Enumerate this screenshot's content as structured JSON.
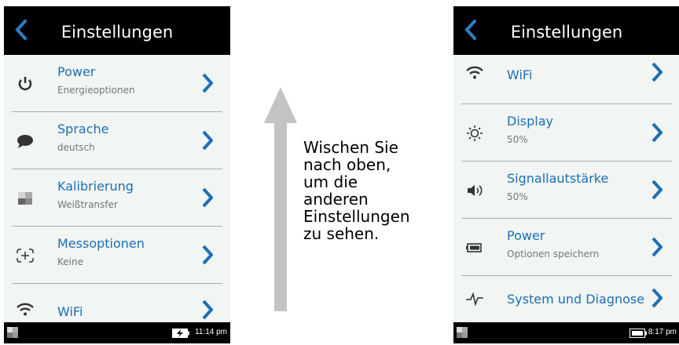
{
  "left_screen": {
    "title": "Einstellungen",
    "items": [
      {
        "label": "Power",
        "subtitle": "Energieoptionen"
      },
      {
        "label": "Sprache",
        "subtitle": "deutsch"
      },
      {
        "label": "Kalibrierung",
        "subtitle": "Weißtransfer"
      },
      {
        "label": "Messoptionen",
        "subtitle": "Keine"
      },
      {
        "label": "WiFi",
        "subtitle": ""
      }
    ],
    "time": "11:14 pm"
  },
  "instruction": "Wischen Sie\nnach oben,\num die\nanderen\nEinstellungen\nzu sehen.",
  "right_screen": {
    "title": "Einstellungen",
    "items": [
      {
        "label": "WiFi",
        "subtitle": ""
      },
      {
        "label": "Display",
        "subtitle": "50%"
      },
      {
        "label": "Signallautstärke",
        "subtitle": "50%"
      },
      {
        "label": "Power",
        "subtitle": "Optionen speichern"
      },
      {
        "label": "System und Diagnose",
        "subtitle": ""
      }
    ],
    "time": "8:17 pm"
  },
  "colors": {
    "accent": "#1c6fb5",
    "header": "#000000",
    "panel": "#f1f5f3",
    "arrow": "#c4c4c4"
  },
  "icons": [
    "back-chevron-icon",
    "power-icon",
    "speech-bubble-icon",
    "calibration-swatch-icon",
    "scan-frame-icon",
    "wifi-icon",
    "sun-icon",
    "speaker-icon",
    "battery-icon",
    "pulse-icon",
    "chevron-right-icon"
  ]
}
